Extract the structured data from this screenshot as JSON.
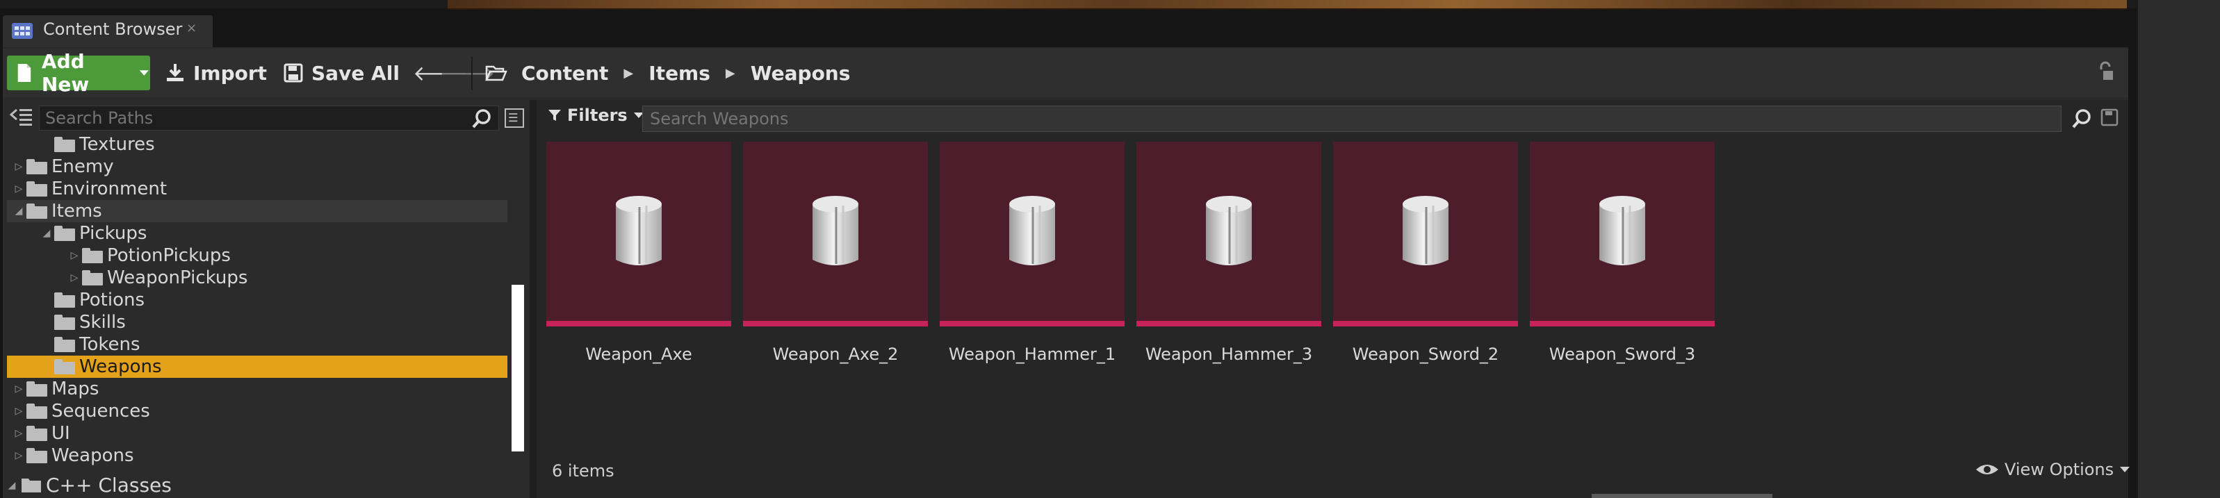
{
  "tab": {
    "title": "Content Browser",
    "close": "×"
  },
  "toolbar": {
    "add_new": "Add New",
    "import": "Import",
    "save_all": "Save All",
    "back": "🡐",
    "forward": "🡒",
    "breadcrumb": [
      "Content",
      "Items",
      "Weapons"
    ]
  },
  "paths": {
    "search_placeholder": "Search Paths",
    "tree": [
      {
        "label": "Textures",
        "level": 2,
        "arrow": ""
      },
      {
        "label": "Enemy",
        "level": 1,
        "arrow": "▷"
      },
      {
        "label": "Environment",
        "level": 1,
        "arrow": "▷"
      },
      {
        "label": "Items",
        "level": 1,
        "arrow": "◢"
      },
      {
        "label": "Pickups",
        "level": 2,
        "arrow": "◢"
      },
      {
        "label": "PotionPickups",
        "level": 3,
        "arrow": "▷"
      },
      {
        "label": "WeaponPickups",
        "level": 3,
        "arrow": "▷"
      },
      {
        "label": "Potions",
        "level": 2,
        "arrow": ""
      },
      {
        "label": "Skills",
        "level": 2,
        "arrow": ""
      },
      {
        "label": "Tokens",
        "level": 2,
        "arrow": ""
      },
      {
        "label": "Weapons",
        "level": 2,
        "arrow": ""
      },
      {
        "label": "Maps",
        "level": 1,
        "arrow": "▷"
      },
      {
        "label": "Sequences",
        "level": 1,
        "arrow": "▷"
      },
      {
        "label": "UI",
        "level": 1,
        "arrow": "▷"
      },
      {
        "label": "Weapons",
        "level": 1,
        "arrow": "▷"
      }
    ],
    "cpp_classes": "C++ Classes"
  },
  "assets": {
    "filters_label": "Filters",
    "search_placeholder": "Search Weapons",
    "items": [
      "Weapon_Axe",
      "Weapon_Axe_2",
      "Weapon_Hammer_1",
      "Weapon_Hammer_3",
      "Weapon_Sword_2",
      "Weapon_Sword_3"
    ],
    "count_label": "6 items",
    "view_options": "View Options"
  },
  "colors": {
    "add_new_bg": "#4c9a3a",
    "selection": "#e3a21a",
    "tile_bg": "#4e1d2b",
    "tile_bar": "#c8225a"
  }
}
